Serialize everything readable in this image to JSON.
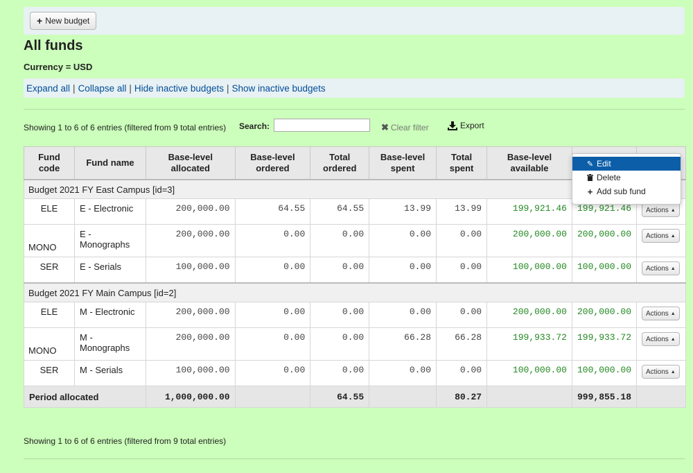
{
  "toolbar": {
    "new_budget_label": "New budget"
  },
  "page": {
    "title": "All funds",
    "currency": "Currency = USD"
  },
  "links": {
    "expand_all": "Expand all",
    "collapse_all": "Collapse all",
    "hide_inactive": "Hide inactive budgets",
    "show_inactive": "Show inactive budgets",
    "separator": "|"
  },
  "info": {
    "top": "Showing 1 to 6 of 6 entries (filtered from 9 total entries)",
    "bottom": "Showing 1 to 6 of 6 entries (filtered from 9 total entries)"
  },
  "search": {
    "label": "Search:",
    "value": ""
  },
  "clear_filter": "Clear filter",
  "export": "Export",
  "table": {
    "headers": {
      "fund_code": "Fund code",
      "fund_name": "Fund name",
      "base_allocated": "Base-level allocated",
      "base_ordered": "Base-level ordered",
      "total_ordered": "Total ordered",
      "base_spent": "Base-level spent",
      "total_spent": "Total spent",
      "base_available": "Base-level available",
      "total_available": "",
      "actions": ""
    },
    "groups": [
      {
        "label": "Budget 2021 FY East Campus [id=3]",
        "rows": [
          {
            "code": "ELE",
            "name": "E - Electronic",
            "base_allocated": "200,000.00",
            "base_ordered": "64.55",
            "total_ordered": "64.55",
            "base_spent": "13.99",
            "total_spent": "13.99",
            "base_available": "199,921.46",
            "total_available": "199,921.46"
          },
          {
            "code": "MONO",
            "name": "E - Monographs",
            "base_allocated": "200,000.00",
            "base_ordered": "0.00",
            "total_ordered": "0.00",
            "base_spent": "0.00",
            "total_spent": "0.00",
            "base_available": "200,000.00",
            "total_available": "200,000.00"
          },
          {
            "code": "SER",
            "name": "E - Serials",
            "base_allocated": "100,000.00",
            "base_ordered": "0.00",
            "total_ordered": "0.00",
            "base_spent": "0.00",
            "total_spent": "0.00",
            "base_available": "100,000.00",
            "total_available": "100,000.00"
          }
        ]
      },
      {
        "label": "Budget 2021 FY Main Campus [id=2]",
        "rows": [
          {
            "code": "ELE",
            "name": "M - Electronic",
            "base_allocated": "200,000.00",
            "base_ordered": "0.00",
            "total_ordered": "0.00",
            "base_spent": "0.00",
            "total_spent": "0.00",
            "base_available": "200,000.00",
            "total_available": "200,000.00"
          },
          {
            "code": "MONO",
            "name": "M - Monographs",
            "base_allocated": "200,000.00",
            "base_ordered": "0.00",
            "total_ordered": "0.00",
            "base_spent": "66.28",
            "total_spent": "66.28",
            "base_available": "199,933.72",
            "total_available": "199,933.72"
          },
          {
            "code": "SER",
            "name": "M - Serials",
            "base_allocated": "100,000.00",
            "base_ordered": "0.00",
            "total_ordered": "0.00",
            "base_spent": "0.00",
            "total_spent": "0.00",
            "base_available": "100,000.00",
            "total_available": "100,000.00"
          }
        ]
      }
    ],
    "actions_label": "Actions",
    "footer": {
      "label": "Period allocated",
      "base_allocated": "1,000,000.00",
      "total_ordered": "64.55",
      "total_spent": "80.27",
      "total_available": "999,855.18"
    }
  },
  "dropdown": {
    "edit": "Edit",
    "delete": "Delete",
    "add_sub_fund": "Add sub fund"
  },
  "colors": {
    "page_bg": "#ccffbb",
    "link": "#004d99",
    "positive_amount": "#228822",
    "menu_highlight": "#0c5ea8"
  }
}
